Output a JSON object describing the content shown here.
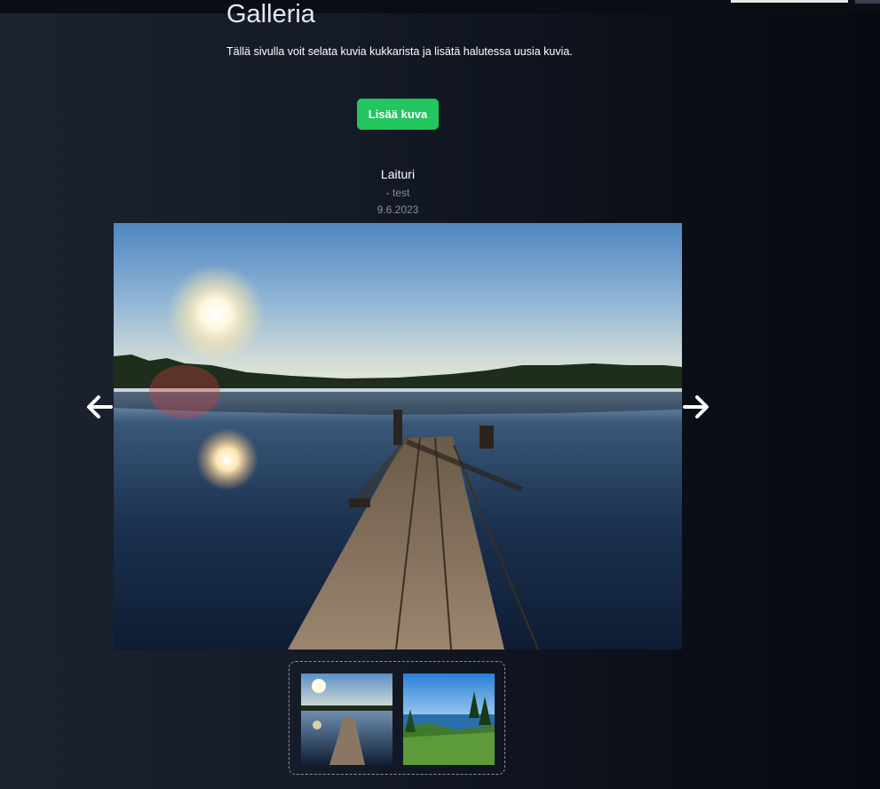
{
  "page": {
    "title": "Galleria",
    "description": "Tällä sivulla voit selata kuvia kukkarista ja lisätä halutessa uusia kuvia."
  },
  "actions": {
    "add_label": "Lisää kuva",
    "accent_color": "#22c55e"
  },
  "current_photo": {
    "title": "Laituri",
    "author": "- test",
    "date": "9.6.2023"
  },
  "carousel": {
    "prev_icon": "arrow-left-icon",
    "next_icon": "arrow-right-icon",
    "thumbnails": [
      {
        "name": "thumbnail-pier"
      },
      {
        "name": "thumbnail-lake-view"
      }
    ]
  }
}
